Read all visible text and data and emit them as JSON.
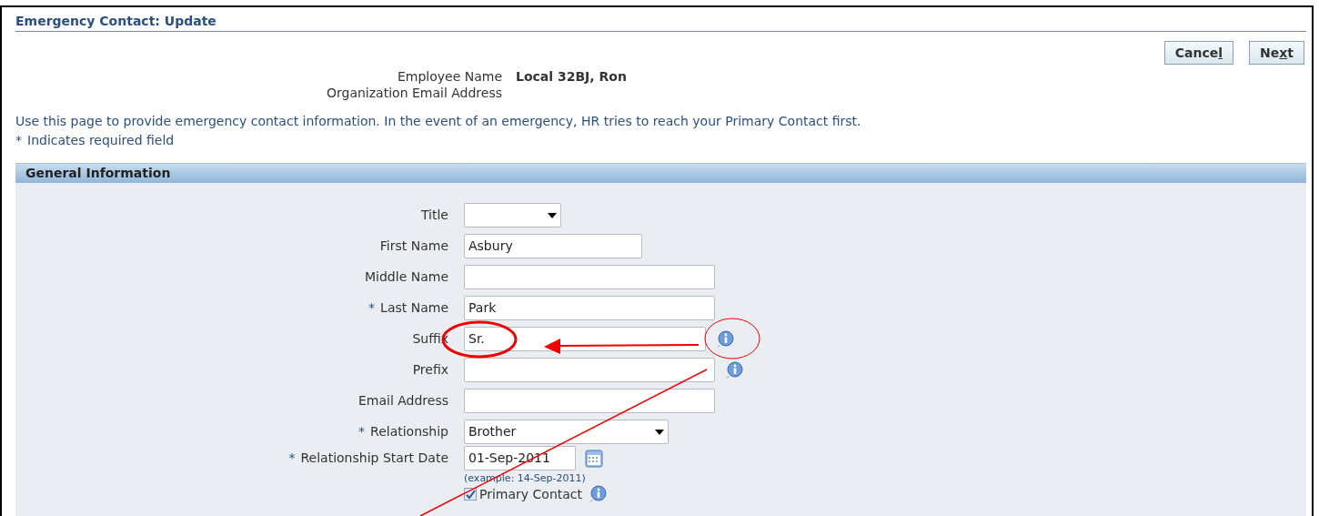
{
  "page": {
    "title": "Emergency Contact: Update"
  },
  "buttons": [
    {
      "label": "Cance",
      "accel": "l"
    },
    {
      "label": "Ne",
      "accel": "x",
      "rest": "t"
    }
  ],
  "employee": [
    {
      "label": "Employee Name",
      "value": "Local 32BJ, Ron"
    },
    {
      "label": "Organization Email Address"
    }
  ],
  "instructions": "Use this page to provide emergency contact information. In the event of an emergency, HR tries to reach your Primary Contact first.",
  "required_note": {
    "mark": "*",
    "text": "Indicates required field"
  },
  "section": {
    "title": "General Information",
    "fields": [
      {
        "kind": "select",
        "label": "Title"
      },
      {
        "kind": "text",
        "label": "First Name",
        "value": "Asbury"
      },
      {
        "kind": "text",
        "label": "Middle Name"
      },
      {
        "kind": "text",
        "label": "Last Name",
        "required_mark": "*",
        "value": "Park"
      },
      {
        "kind": "text",
        "label": "Suffix",
        "value": "Sr.",
        "info": true
      },
      {
        "kind": "text",
        "label": "Prefix",
        "info": true
      },
      {
        "kind": "text",
        "label": "Email Address"
      },
      {
        "kind": "select",
        "label": "Relationship",
        "required_mark": "*",
        "value": "Brother"
      },
      {
        "kind": "date",
        "label": "Relationship Start Date",
        "required_mark": "*",
        "value": "01-Sep-2011",
        "hint": "(example: 14-Sep-2011)"
      },
      {
        "kind": "checkbox",
        "label": "Primary Contact",
        "checked": true,
        "info": true
      }
    ]
  }
}
